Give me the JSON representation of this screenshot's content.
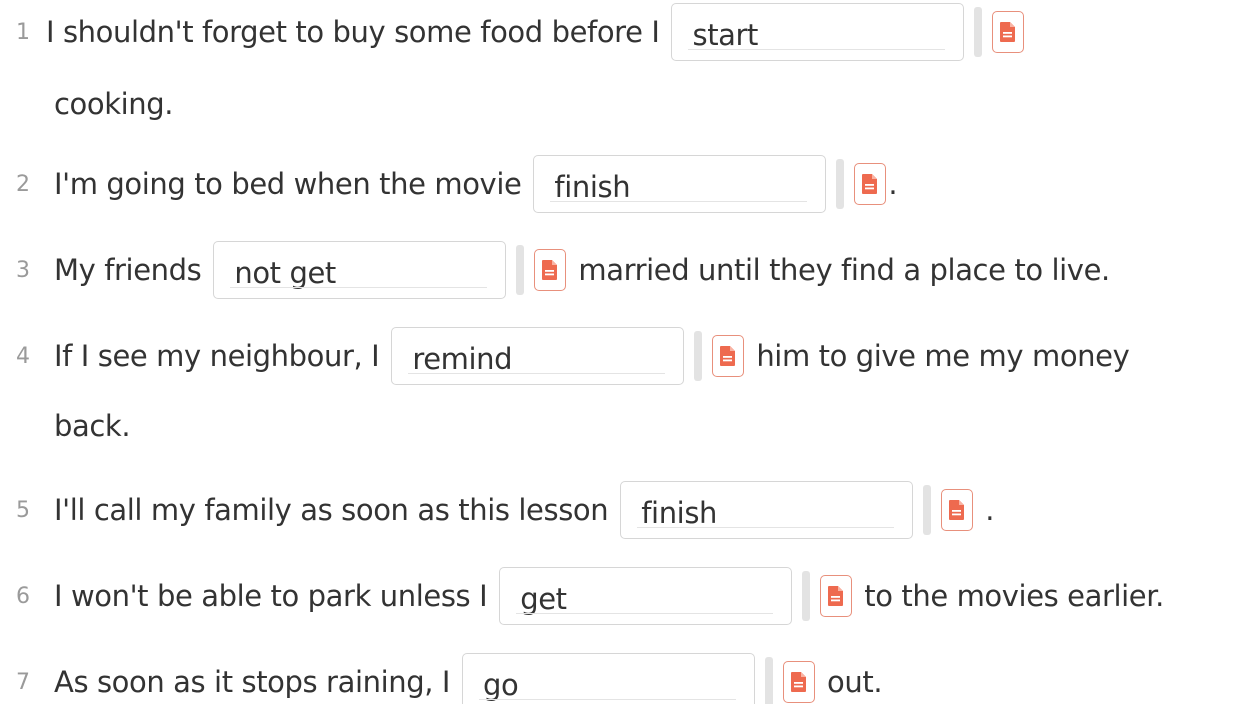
{
  "colors": {
    "icon_accent": "#ee6a4f",
    "icon_border": "#e8907c",
    "text": "#333333",
    "number": "#9a9a9a",
    "separator": "#e3e3e3",
    "input_border": "#d6d6d6"
  },
  "icon": "document-icon",
  "items": [
    {
      "number": "1",
      "before": "I shouldn't forget to buy some food before I",
      "answer": "start",
      "after": "",
      "continuation": "cooking."
    },
    {
      "number": "2",
      "before": "I'm going to bed when the movie",
      "answer": "finish",
      "after": "."
    },
    {
      "number": "3",
      "before": "My friends",
      "answer": "not get",
      "after": "married until they find a place to live."
    },
    {
      "number": "4",
      "before": "If I see my neighbour, I",
      "answer": "remind",
      "after": "him to give me my money",
      "continuation": "back."
    },
    {
      "number": "5",
      "before": "I'll call my family as soon as this lesson",
      "answer": "finish",
      "after": "."
    },
    {
      "number": "6",
      "before": "I won't be able to park unless I",
      "answer": "get",
      "after": "to the movies earlier."
    },
    {
      "number": "7",
      "before": "As soon as it stops raining, I",
      "answer": "go",
      "after": "out."
    }
  ]
}
